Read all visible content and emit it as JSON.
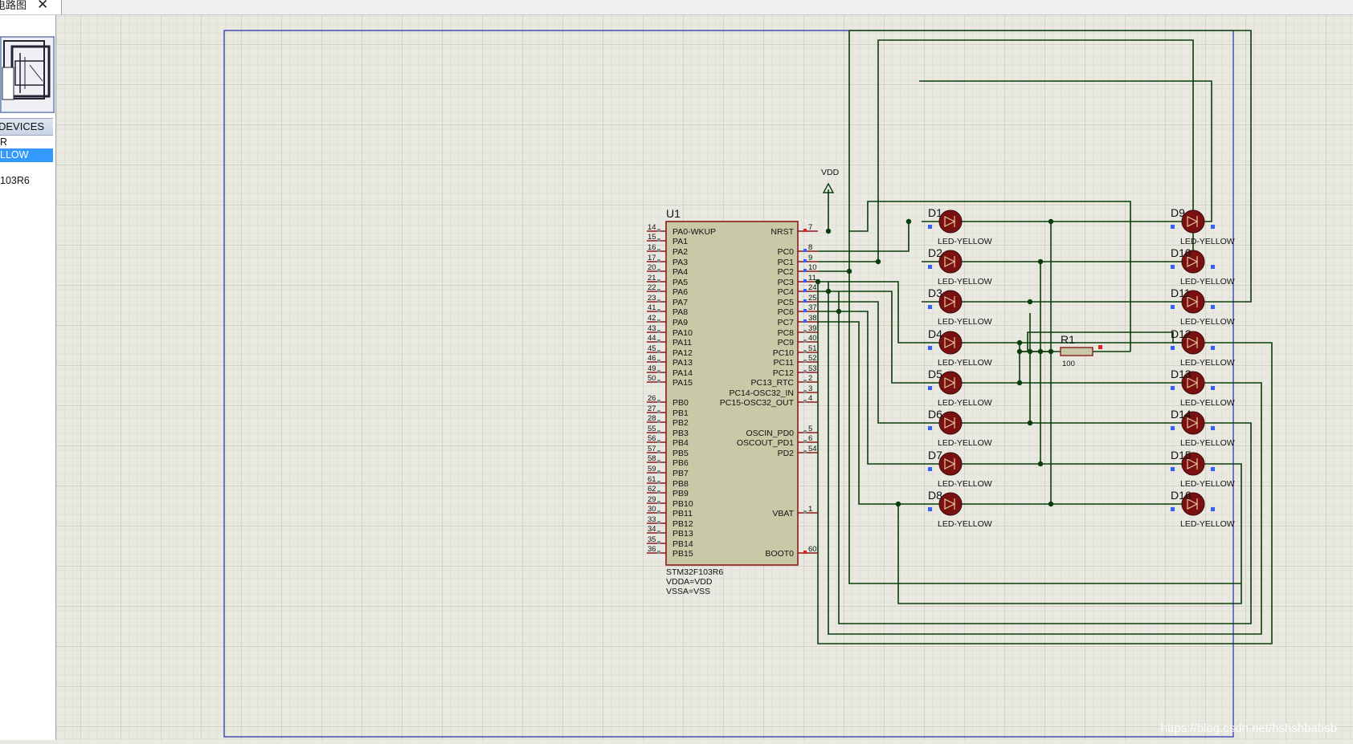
{
  "tab": {
    "label": "电路图",
    "close_glyph": "✕"
  },
  "sidebar": {
    "devices_header": "DEVICES",
    "devices": [
      {
        "label": "R",
        "selected": false
      },
      {
        "label": "LLOW",
        "selected": true
      },
      {
        "label": "",
        "selected": false
      },
      {
        "label": "103R6",
        "selected": false
      }
    ]
  },
  "schematic": {
    "mcu": {
      "ref": "U1",
      "part": "STM32F103R6",
      "props": [
        "VDDA=VDD",
        "VSSA=VSS"
      ],
      "left_pins": [
        {
          "num": "14",
          "name": "PA0-WKUP"
        },
        {
          "num": "15",
          "name": "PA1"
        },
        {
          "num": "16",
          "name": "PA2"
        },
        {
          "num": "17",
          "name": "PA3"
        },
        {
          "num": "20",
          "name": "PA4"
        },
        {
          "num": "21",
          "name": "PA5"
        },
        {
          "num": "22",
          "name": "PA6"
        },
        {
          "num": "23",
          "name": "PA7"
        },
        {
          "num": "41",
          "name": "PA8"
        },
        {
          "num": "42",
          "name": "PA9"
        },
        {
          "num": "43",
          "name": "PA10"
        },
        {
          "num": "44",
          "name": "PA11"
        },
        {
          "num": "45",
          "name": "PA12"
        },
        {
          "num": "46",
          "name": "PA13"
        },
        {
          "num": "49",
          "name": "PA14"
        },
        {
          "num": "50",
          "name": "PA15"
        },
        {
          "num": "26",
          "name": "PB0"
        },
        {
          "num": "27",
          "name": "PB1"
        },
        {
          "num": "28",
          "name": "PB2"
        },
        {
          "num": "55",
          "name": "PB3"
        },
        {
          "num": "56",
          "name": "PB4"
        },
        {
          "num": "57",
          "name": "PB5"
        },
        {
          "num": "58",
          "name": "PB6"
        },
        {
          "num": "59",
          "name": "PB7"
        },
        {
          "num": "61",
          "name": "PB8"
        },
        {
          "num": "62",
          "name": "PB9"
        },
        {
          "num": "29",
          "name": "PB10"
        },
        {
          "num": "30",
          "name": "PB11"
        },
        {
          "num": "33",
          "name": "PB12"
        },
        {
          "num": "34",
          "name": "PB13"
        },
        {
          "num": "35",
          "name": "PB14"
        },
        {
          "num": "36",
          "name": "PB15"
        }
      ],
      "right_pins": [
        {
          "num": "7",
          "name": "NRST"
        },
        {
          "num": "8",
          "name": "PC0"
        },
        {
          "num": "9",
          "name": "PC1"
        },
        {
          "num": "10",
          "name": "PC2"
        },
        {
          "num": "11",
          "name": "PC3"
        },
        {
          "num": "24",
          "name": "PC4"
        },
        {
          "num": "25",
          "name": "PC5"
        },
        {
          "num": "37",
          "name": "PC6"
        },
        {
          "num": "38",
          "name": "PC7"
        },
        {
          "num": "39",
          "name": "PC8"
        },
        {
          "num": "40",
          "name": "PC9"
        },
        {
          "num": "51",
          "name": "PC10"
        },
        {
          "num": "52",
          "name": "PC11"
        },
        {
          "num": "53",
          "name": "PC12"
        },
        {
          "num": "2",
          "name": "PC13_RTC"
        },
        {
          "num": "3",
          "name": "PC14-OSC32_IN"
        },
        {
          "num": "4",
          "name": "PC15-OSC32_OUT"
        },
        {
          "num": "5",
          "name": "OSCIN_PD0"
        },
        {
          "num": "6",
          "name": "OSCOUT_PD1"
        },
        {
          "num": "54",
          "name": "PD2"
        },
        {
          "num": "1",
          "name": "VBAT"
        },
        {
          "num": "60",
          "name": "BOOT0"
        }
      ]
    },
    "vdd_label": "VDD",
    "resistor": {
      "ref": "R1",
      "value": "100"
    },
    "leds_left": [
      "D1",
      "D2",
      "D3",
      "D4",
      "D5",
      "D6",
      "D7",
      "D8"
    ],
    "leds_right": [
      "D9",
      "D10",
      "D11",
      "D12",
      "D13",
      "D14",
      "D15",
      "D16"
    ],
    "led_part": "LED-YELLOW"
  },
  "watermark": "https://blog.csdn.net/hshshbabsb",
  "colors": {
    "grid_bg": "#e9e9e1",
    "wire": "#0b3d0b",
    "component_red": "#8b1a1a",
    "chip_fill": "#c9c9a8",
    "led_fill": "#7a1010"
  }
}
